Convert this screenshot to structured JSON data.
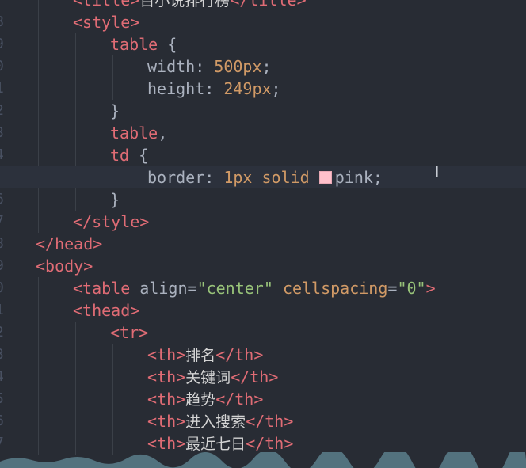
{
  "line_numbers": [
    "",
    "8",
    "9",
    "0",
    "1",
    "2",
    "3",
    "4",
    "5",
    "6",
    "7",
    "8",
    "9",
    "0",
    "1",
    "2",
    "3",
    "4",
    "5",
    "6",
    "7"
  ],
  "lines": [
    [
      [
        "tag",
        "<title>"
      ],
      [
        "cn",
        "百小说排行榜"
      ],
      [
        "tag",
        "</title>"
      ]
    ],
    [
      [
        "tag",
        "<style>"
      ]
    ],
    [
      [
        "tag",
        "table"
      ],
      [
        "plain",
        " {"
      ]
    ],
    [
      [
        "plain",
        "width: "
      ],
      [
        "attr",
        "500px"
      ],
      [
        "plain",
        ";"
      ]
    ],
    [
      [
        "plain",
        "height: "
      ],
      [
        "attr",
        "249px"
      ],
      [
        "plain",
        ";"
      ]
    ],
    [
      [
        "plain",
        "}"
      ]
    ],
    [
      [
        "tag",
        "table"
      ],
      [
        "plain",
        ","
      ]
    ],
    [
      [
        "tag",
        "td"
      ],
      [
        "plain",
        " {"
      ]
    ],
    [
      [
        "plain",
        "border: "
      ],
      [
        "attr",
        "1px solid "
      ],
      [
        "swatch",
        ""
      ],
      [
        "plain",
        "pink;"
      ]
    ],
    [
      [
        "plain",
        "}"
      ]
    ],
    [
      [
        "tag",
        "</style>"
      ]
    ],
    [
      [
        "tag",
        "</head>"
      ]
    ],
    [
      [
        "tag",
        "<body>"
      ]
    ],
    [
      [
        "tag",
        "<table "
      ],
      [
        "plain",
        "align"
      ],
      [
        "plain",
        "="
      ],
      [
        "str",
        "\"center\""
      ],
      [
        "plain",
        " "
      ],
      [
        "attr",
        "cellspacing"
      ],
      [
        "plain",
        "="
      ],
      [
        "str",
        "\"0\""
      ],
      [
        "tag",
        ">"
      ]
    ],
    [
      [
        "tag",
        "<thead>"
      ]
    ],
    [
      [
        "tag",
        "<tr>"
      ]
    ],
    [
      [
        "tag",
        "<th>"
      ],
      [
        "cn",
        "排名"
      ],
      [
        "tag",
        "</th>"
      ]
    ],
    [
      [
        "tag",
        "<th>"
      ],
      [
        "cn",
        "关键词"
      ],
      [
        "tag",
        "</th>"
      ]
    ],
    [
      [
        "tag",
        "<th>"
      ],
      [
        "cn",
        "趋势"
      ],
      [
        "tag",
        "</th>"
      ]
    ],
    [
      [
        "tag",
        "<th>"
      ],
      [
        "cn",
        "进入搜索"
      ],
      [
        "tag",
        "</th>"
      ]
    ],
    [
      [
        "tag",
        "<th>"
      ],
      [
        "cn",
        "最近七日"
      ],
      [
        "tag",
        "</th>"
      ]
    ]
  ],
  "indents": [
    2,
    2,
    3,
    4,
    4,
    3,
    3,
    3,
    4,
    3,
    2,
    1,
    1,
    2,
    2,
    3,
    4,
    4,
    4,
    4,
    4
  ],
  "current_line_index": 8,
  "colors": {
    "background": "#282c34",
    "tag": "#e06c75",
    "attribute_value": "#d19a66",
    "string": "#98c379",
    "swatch_pink": "#ffc0cb"
  },
  "icons": [
    "text-cursor-icon"
  ]
}
